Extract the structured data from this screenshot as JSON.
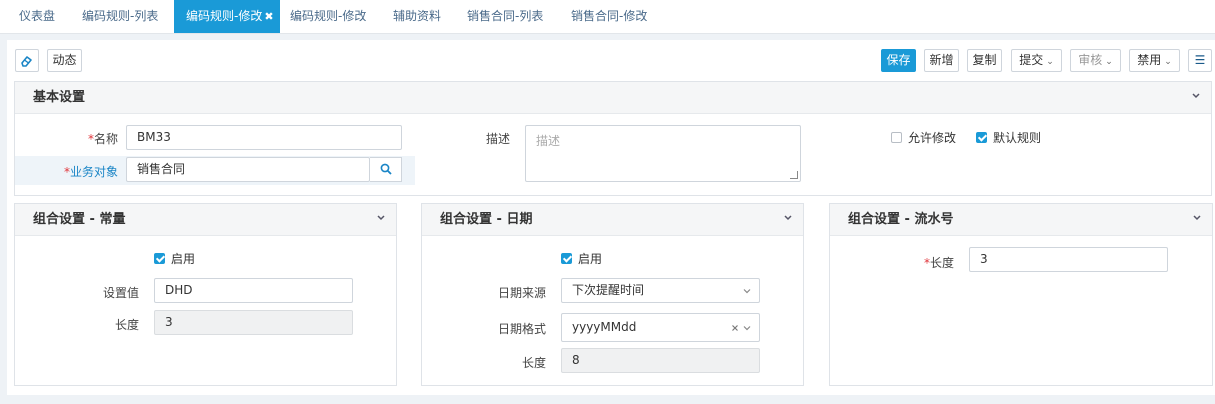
{
  "tabs": [
    {
      "label": "仪表盘"
    },
    {
      "label": "编码规则-列表"
    },
    {
      "label": "编码规则-修改",
      "close": "✖"
    },
    {
      "label": "编码规则-修改"
    },
    {
      "label": "辅助资料"
    },
    {
      "label": "销售合同-列表"
    },
    {
      "label": "销售合同-修改"
    }
  ],
  "toolbar": {
    "dynamic": "动态",
    "save": "保存",
    "add": "新增",
    "copy": "复制",
    "submit": "提交",
    "review": "审核",
    "disable": "禁用",
    "caret": "⌄",
    "menu": "☰"
  },
  "basic": {
    "title": "基本设置",
    "name_label": "名称",
    "name_value": "BM33",
    "object_label": "业务对象",
    "object_value": "销售合同",
    "desc_label": "描述",
    "desc_placeholder": "描述",
    "allow_edit": "允许修改",
    "allow_edit_checked": false,
    "default_rule": "默认规则",
    "default_rule_checked": true
  },
  "constant": {
    "title": "组合设置 - 常量",
    "enable": "启用",
    "enable_checked": true,
    "value_label": "设置值",
    "value": "DHD",
    "length_label": "长度",
    "length": "3"
  },
  "date": {
    "title": "组合设置 - 日期",
    "enable": "启用",
    "enable_checked": true,
    "source_label": "日期来源",
    "source": "下次提醒时间",
    "format_label": "日期格式",
    "format": "yyyyMMdd",
    "length_label": "长度",
    "length": "8"
  },
  "serial": {
    "title": "组合设置 - 流水号",
    "length_label": "长度",
    "length": "3"
  },
  "colors": {
    "accent": "#1a9ad7",
    "required": "#e0353b",
    "link": "#1a85c6"
  }
}
